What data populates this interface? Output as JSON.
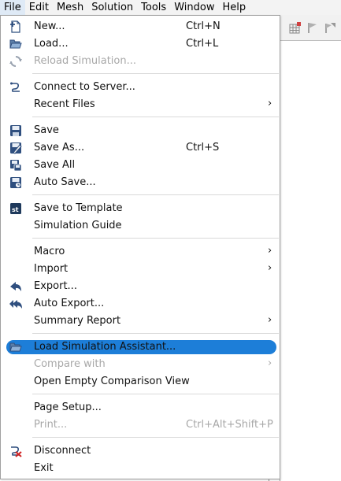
{
  "menubar": {
    "items": [
      "File",
      "Edit",
      "Mesh",
      "Solution",
      "Tools",
      "Window",
      "Help"
    ]
  },
  "file_menu": {
    "new": {
      "label": "New...",
      "shortcut": "Ctrl+N"
    },
    "load": {
      "label": "Load...",
      "shortcut": "Ctrl+L"
    },
    "reload": {
      "label": "Reload Simulation..."
    },
    "connect": {
      "label": "Connect to Server..."
    },
    "recent": {
      "label": "Recent Files",
      "arrow": "›"
    },
    "save": {
      "label": "Save"
    },
    "save_as": {
      "label": "Save As...",
      "shortcut": "Ctrl+S"
    },
    "save_all": {
      "label": "Save All"
    },
    "auto_save": {
      "label": "Auto Save..."
    },
    "save_template": {
      "label": "Save to Template"
    },
    "sim_guide": {
      "label": "Simulation Guide"
    },
    "macro": {
      "label": "Macro",
      "arrow": "›"
    },
    "import": {
      "label": "Import",
      "arrow": "›"
    },
    "export": {
      "label": "Export..."
    },
    "auto_export": {
      "label": "Auto Export..."
    },
    "summary": {
      "label": "Summary Report",
      "arrow": "›"
    },
    "load_assistant": {
      "label": "Load Simulation Assistant..."
    },
    "compare": {
      "label": "Compare with",
      "arrow": "›"
    },
    "open_compare": {
      "label": "Open Empty Comparison View"
    },
    "page_setup": {
      "label": "Page Setup..."
    },
    "print": {
      "label": "Print...",
      "shortcut": "Ctrl+Alt+Shift+P"
    },
    "disconnect": {
      "label": "Disconnect"
    },
    "exit": {
      "label": "Exit"
    }
  },
  "colors": {
    "highlight": "#1d7ed8",
    "menubar_bg": "#f3f3f3",
    "disabled": "#a8a8a8"
  }
}
